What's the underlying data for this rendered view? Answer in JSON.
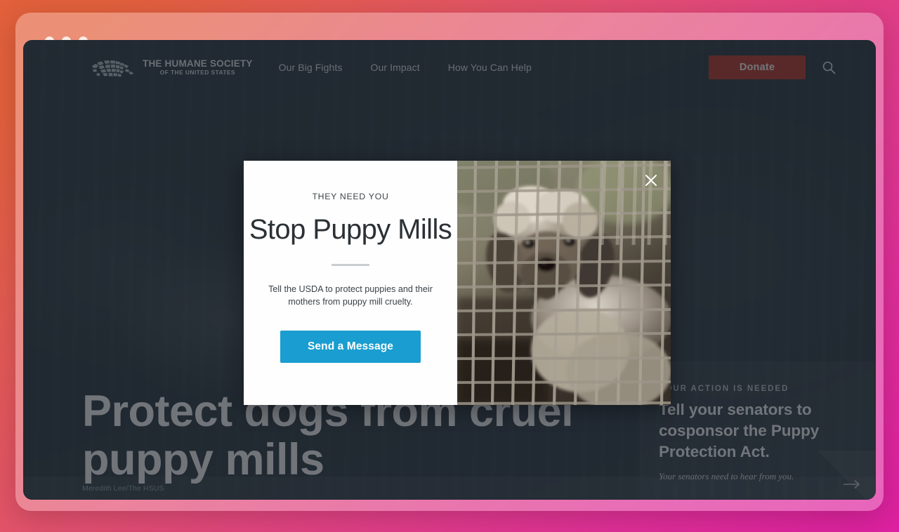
{
  "window": {
    "controls": [
      "close",
      "minimize",
      "maximize"
    ]
  },
  "site": {
    "brand": {
      "line1": "THE HUMANE SOCIETY",
      "line2": "OF THE UNITED STATES",
      "logo_icon": "usa-map-icon"
    },
    "nav": [
      {
        "label": "Our Big Fights"
      },
      {
        "label": "Our Impact"
      },
      {
        "label": "How You Can Help"
      }
    ],
    "donate_label": "Donate",
    "search_icon": "search-icon"
  },
  "hero": {
    "heading": "Protect dogs from cruel puppy mills",
    "photo_credit": "Meredith Lee/The HSUS"
  },
  "action_card": {
    "eyebrow": "YOUR ACTION IS NEEDED",
    "title": "Tell your senators to cosponsor the Puppy Protection Act.",
    "subtitle": "Your senators need to hear from you.",
    "next_icon": "arrow-right-icon"
  },
  "modal": {
    "eyebrow": "THEY NEED YOU",
    "title": "Stop Puppy Mills",
    "body": "Tell the USDA to protect puppies and their mothers from puppy mill cruelty.",
    "cta_label": "Send a Message",
    "close_icon": "close-icon",
    "photo_alt": "dog-in-cage-photo"
  },
  "colors": {
    "donate_red": "#c0392b",
    "cta_blue": "#1a9dd0",
    "page_dark": "#2f3a44",
    "desktop_gradient_start": "#e2603c",
    "desktop_gradient_end": "#dd20a0"
  }
}
